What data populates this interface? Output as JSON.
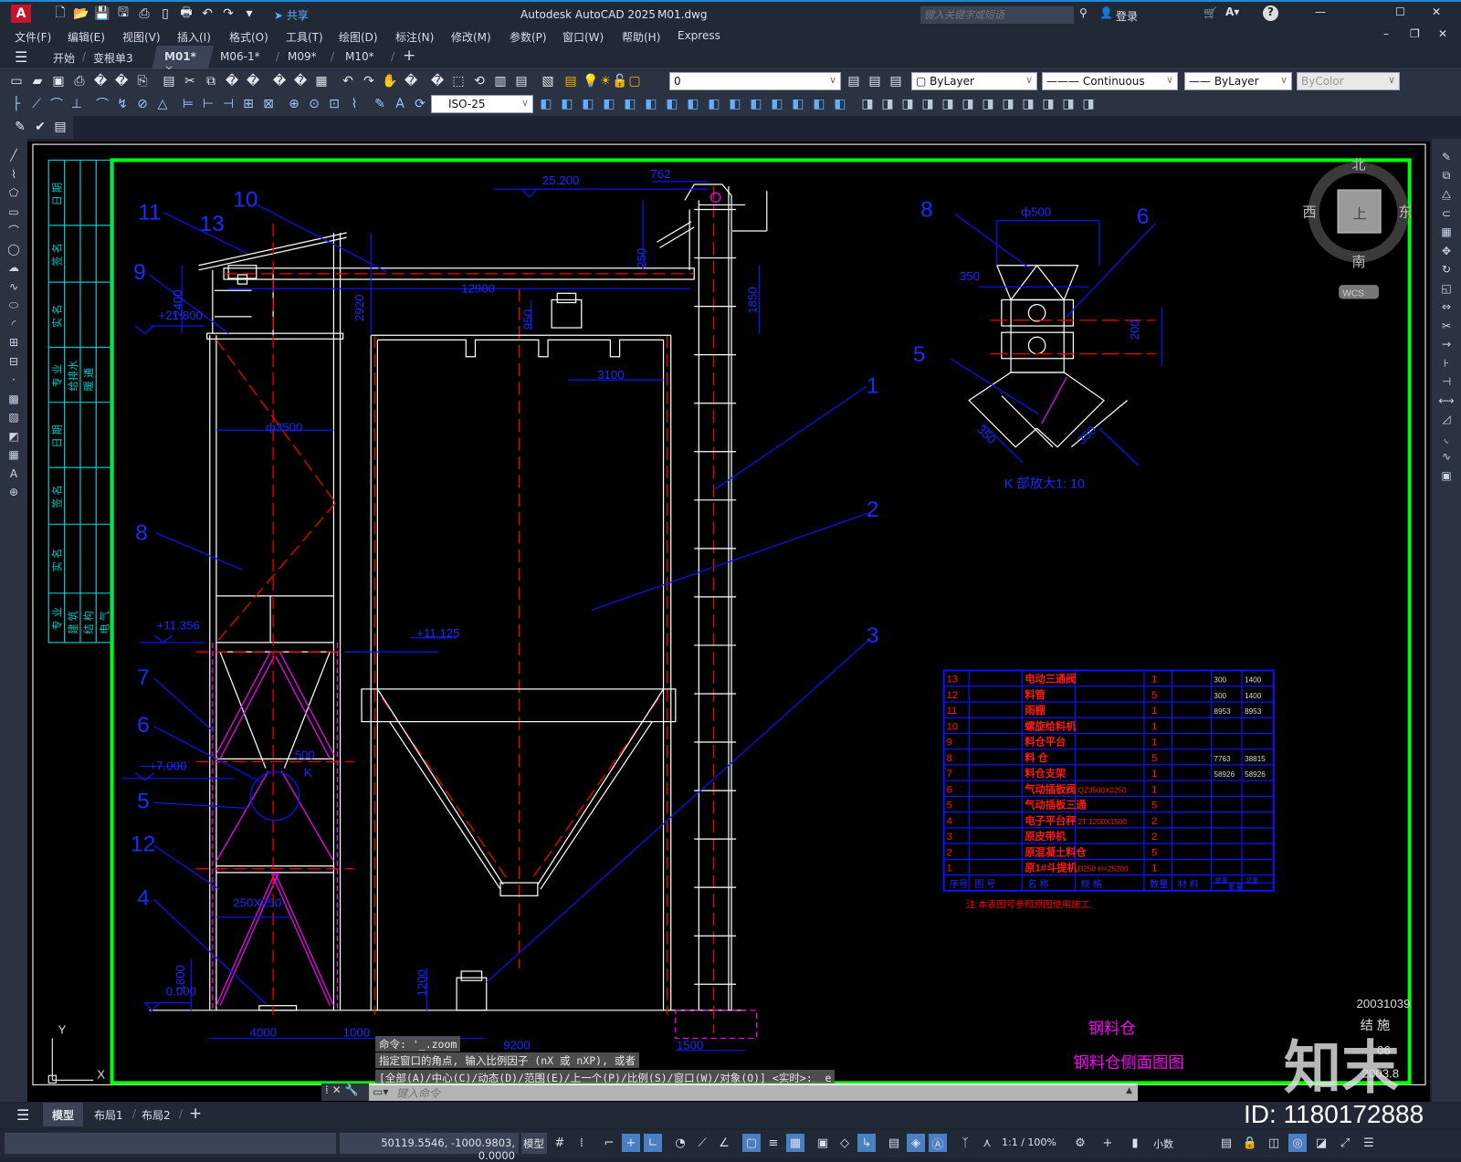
{
  "app": {
    "title": "Autodesk AutoCAD 2025",
    "file": "M01.dwg",
    "share": "共享",
    "search_placeholder": "键入关键字或短语",
    "login": "登录"
  },
  "quick_access": [
    "app-logo-icon",
    "new-icon",
    "open-icon",
    "save-icon",
    "saveas-icon",
    "publish-icon",
    "mobile-icon",
    "print-icon",
    "undo-icon",
    "redo-icon",
    "customize-icon",
    "share-icon"
  ],
  "menu": [
    "文件(F)",
    "编辑(E)",
    "视图(V)",
    "插入(I)",
    "格式(O)",
    "工具(T)",
    "绘图(D)",
    "标注(N)",
    "修改(M)",
    "参数(P)",
    "窗口(W)",
    "帮助(H)",
    "Express"
  ],
  "tabs": [
    {
      "label": "开始"
    },
    {
      "label": "变根单3"
    },
    {
      "label": "M01*",
      "active": true
    },
    {
      "label": "M06-1*"
    },
    {
      "label": "M09*"
    },
    {
      "label": "M10*"
    }
  ],
  "toolbar": {
    "row1_icons": [
      "new",
      "open",
      "save",
      "plot",
      "plot-preview",
      "publish",
      "dwf",
      "cut",
      "copy",
      "paste",
      "match-properties",
      "block-editor",
      "undo",
      "redo",
      "pan",
      "zoom-realtime",
      "zoom-window",
      "zoom-previous",
      "properties",
      "design-center",
      "tool-palettes",
      "sheet-set",
      "markup",
      "calculator",
      "help"
    ],
    "layer_icons": [
      "layer-properties",
      "layer-on",
      "freeze",
      "lock",
      "layer-color"
    ],
    "layer": "0",
    "color": "ByLayer",
    "linetype": "Continuous",
    "lineweight": "ByLayer",
    "plotstyle": "ByColor",
    "row2_icons": [
      "linear-dim",
      "aligned-dim",
      "arc-length",
      "ordinate",
      "radius",
      "jogged",
      "diameter",
      "angular",
      "quick-dim",
      "baseline",
      "continue",
      "dim-space",
      "dim-break",
      "tolerance",
      "center-mark",
      "inspect",
      "jogged-linear",
      "dim-edit",
      "dim-text-edit",
      "dim-update"
    ],
    "dimstyle": "ISO-25",
    "row3_icons": [
      "edit-attribute",
      "check-spelling",
      "layer-tool"
    ]
  },
  "left_palette": [
    "line",
    "polyline",
    "polygon",
    "rectangle",
    "arc",
    "circle",
    "revcloud",
    "spline",
    "ellipse",
    "ellipse-arc",
    "insert-block",
    "make-block",
    "point",
    "hatch",
    "gradient",
    "region",
    "table",
    "mtext",
    "add-selected"
  ],
  "right_palette": [
    "erase",
    "copy",
    "mirror",
    "offset",
    "array",
    "move",
    "rotate",
    "scale",
    "stretch",
    "trim",
    "extend",
    "break-at-point",
    "break",
    "join",
    "chamfer",
    "fillet",
    "blend",
    "explode"
  ],
  "viewcube": {
    "north": "北",
    "south": "南",
    "east": "东",
    "west": "西",
    "face": "上",
    "wcs": "WCS"
  },
  "drawing": {
    "dims": [
      "25.200",
      "762",
      "250",
      "12900",
      "2920",
      "1850",
      "950",
      "3100",
      "2400",
      "+21.800",
      "ф3500",
      "+11.356",
      "+11.125",
      "500",
      "K",
      "+7.000",
      "250X250",
      "1200",
      "0.000",
      "1800",
      "4000",
      "1000",
      "9200",
      "1500"
    ],
    "leaders": [
      "11",
      "13",
      "10",
      "9",
      "8",
      "7",
      "6",
      "5",
      "12",
      "4",
      "1",
      "2",
      "3"
    ],
    "detail": {
      "leaders": [
        "8",
        "6",
        "5"
      ],
      "dims": [
        "ф500",
        "350",
        "200",
        "350",
        "350"
      ],
      "caption": "K 部放大1: 10"
    },
    "strip": {
      "col1": [
        "日 期",
        "签 名",
        "实 名",
        "专 业",
        "日 期",
        "签 名",
        "实 名",
        "专 业"
      ],
      "col2": [
        "给排水",
        "建 筑"
      ],
      "col3": [
        "暖 通",
        "结 构"
      ],
      "col4": [
        "电 气"
      ]
    },
    "bom": {
      "rows": [
        [
          "13",
          "",
          "电动三通阀",
          "",
          "1",
          "",
          "300",
          "1400"
        ],
        [
          "12",
          "",
          "料管",
          "",
          "5",
          "",
          "300",
          "1400"
        ],
        [
          "11",
          "",
          "雨棚",
          "",
          "1",
          "",
          "8953",
          "8953"
        ],
        [
          "10",
          "",
          "螺旋给料机",
          "",
          "1",
          "",
          "",
          ""
        ],
        [
          "9",
          "",
          "料仓平台",
          "",
          "1",
          "",
          "",
          ""
        ],
        [
          "8",
          "",
          "料 仓",
          "",
          "5",
          "",
          "7763",
          "38815"
        ],
        [
          "7",
          "",
          "料仓支架",
          "",
          "1",
          "",
          "58926",
          "58926"
        ],
        [
          "6",
          "",
          "气动插板阀",
          "QZ3500X0250",
          "1",
          "",
          "",
          ""
        ],
        [
          "5",
          "",
          "气动插板三通",
          "",
          "5",
          "",
          "",
          ""
        ],
        [
          "4",
          "",
          "电子平台秤",
          "2T 1200X1500",
          "2",
          "",
          "",
          ""
        ],
        [
          "3",
          "",
          "原皮带机",
          "",
          "2",
          "",
          "",
          ""
        ],
        [
          "2",
          "",
          "原混凝土料仓",
          "",
          "5",
          "",
          "",
          ""
        ],
        [
          "1",
          "",
          "原1#斗提机",
          "D250 H=25200",
          "1",
          "",
          "",
          ""
        ]
      ],
      "header": [
        "序号",
        "图 号",
        "名 称",
        "规 格",
        "数量",
        "材 料",
        "单重",
        "总重"
      ],
      "header_sub": "重 量",
      "note": "注:本表图号参照原图使用施工."
    },
    "titleblock": {
      "project": "钢料仓",
      "sheet_title": "钢料仓侧面图图",
      "number": "20031039",
      "discipline": "结 施",
      "sheet": "06",
      "date": "2003.8"
    },
    "ucs": {
      "x": "X",
      "y": "Y"
    },
    "watermark": {
      "logo": "知末",
      "id": "ID: 1180172888"
    }
  },
  "command": {
    "history": [
      "命令:  '_.zoom",
      "指定窗口的角点, 输入比例因子 (nX 或 nXP), 或者",
      "[全部(A)/中心(C)/动态(D)/范围(E)/上一个(P)/比例(S)/窗口(W)/对象(O)] <实时>: _e"
    ],
    "placeholder": "键入命令"
  },
  "layout_tabs": [
    "模型",
    "布局1",
    "布局2"
  ],
  "status": {
    "coords": "50119.5546, -1000.9803, 0.0000",
    "space": "模型",
    "scale": "1:1 / 100%",
    "units": "小数",
    "icons": [
      {
        "n": "grid",
        "g": "#",
        "on": false
      },
      {
        "n": "snap",
        "g": "⁞",
        "on": false
      },
      {
        "n": "infer",
        "g": "⌐",
        "on": false
      },
      {
        "n": "dynamic-input",
        "g": "+",
        "on": true
      },
      {
        "n": "ortho",
        "g": "∟",
        "on": true
      },
      {
        "n": "polar",
        "g": "◔",
        "on": false
      },
      {
        "n": "isodraft",
        "g": "⟋",
        "on": false
      },
      {
        "n": "object-snap-tracking",
        "g": "∠",
        "on": false
      },
      {
        "n": "object-snap",
        "g": "▢",
        "on": true
      },
      {
        "n": "lineweight",
        "g": "≡",
        "on": false
      },
      {
        "n": "transparency",
        "g": "▦",
        "on": true
      },
      {
        "n": "selection-cycling",
        "g": "▣",
        "on": false
      },
      {
        "n": "3d-osnap",
        "g": "◇",
        "on": false
      },
      {
        "n": "dynamic-ucs",
        "g": "↳",
        "on": true
      },
      {
        "n": "selection-filter",
        "g": "▤",
        "on": false
      },
      {
        "n": "gizmo",
        "g": "◈",
        "on": true
      },
      {
        "n": "annotation-visibility",
        "g": "Ⓐ",
        "on": true
      },
      {
        "n": "auto-scale",
        "g": "ᛉ",
        "on": false
      },
      {
        "n": "annotation-scale",
        "g": "⋏",
        "on": false
      }
    ],
    "icons2": [
      {
        "n": "workspace",
        "g": "⚙"
      },
      {
        "n": "annotation-monitor",
        "g": "+"
      },
      {
        "n": "units-icon",
        "g": "▮"
      }
    ],
    "icons3": [
      {
        "n": "quick-properties",
        "g": "▤"
      },
      {
        "n": "lock-ui",
        "g": "🔒"
      },
      {
        "n": "isolate-objects",
        "g": "◫"
      },
      {
        "n": "hardware-acceleration",
        "g": "◎",
        "on": true
      },
      {
        "n": "graphics-performance",
        "g": "◪"
      },
      {
        "n": "clean-screen",
        "g": "⤢"
      },
      {
        "n": "customization",
        "g": "☰"
      }
    ]
  }
}
